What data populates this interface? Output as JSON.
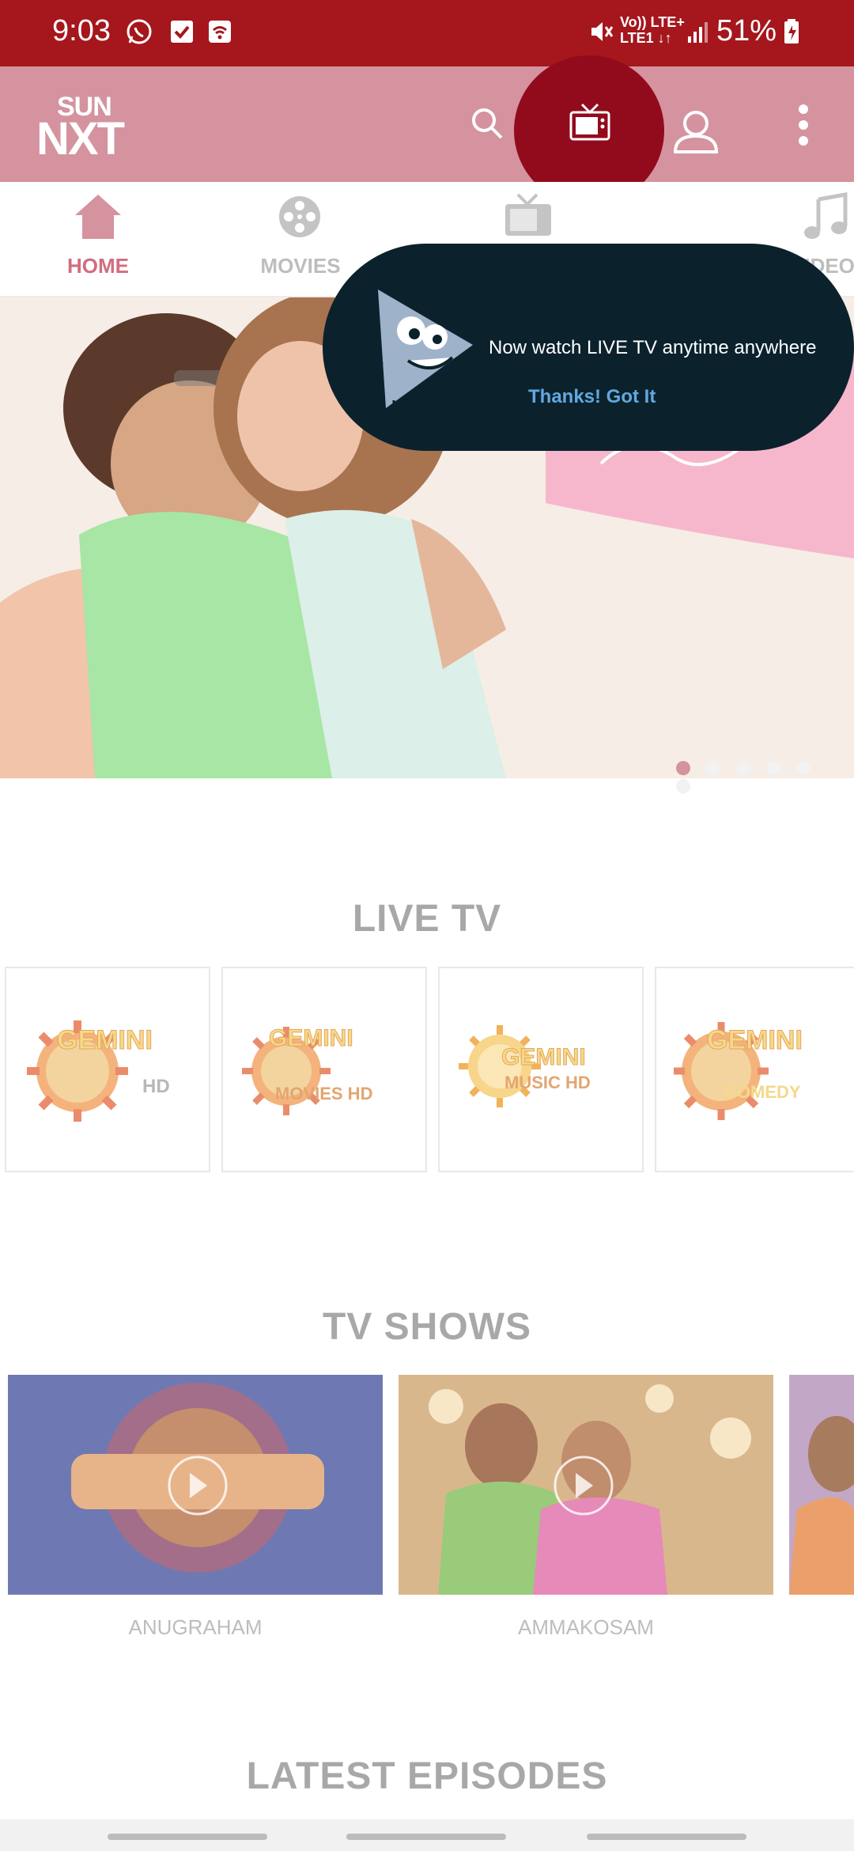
{
  "status_bar": {
    "time": "9:03",
    "lte_top": "Vo)) LTE+",
    "lte_bottom": "LTE1 ↓↑",
    "battery": "51%"
  },
  "app_bar": {
    "logo_top": "SUN",
    "logo_bottom": "NXT",
    "icons": [
      "search-icon",
      "live-tv-icon",
      "profile-icon",
      "more-vert-icon"
    ],
    "background_color": "#d4939f",
    "highlight_color": "#920b1d"
  },
  "tabs": [
    {
      "label": "HOME",
      "icon": "home-icon",
      "active": true
    },
    {
      "label": "MOVIES",
      "icon": "film-reel-icon",
      "active": false
    },
    {
      "label": "",
      "icon": "tv-icon",
      "active": false
    },
    {
      "label": "VIDEOS",
      "icon": "music-note-icon",
      "active": false
    }
  ],
  "tooltip": {
    "message": "Now watch LIVE TV anytime anywhere",
    "button": "Thanks! Got It"
  },
  "banner": {
    "slide_count": 6,
    "active_slide": 1
  },
  "live_tv": {
    "title": "LIVE TV",
    "channels": [
      {
        "name": "GEMINI",
        "suffix": "HD"
      },
      {
        "name": "GEMINI",
        "suffix": "MOVIES HD"
      },
      {
        "name": "GEMINI",
        "suffix": "MUSIC HD"
      },
      {
        "name": "GEMINI",
        "suffix": "COMEDY"
      }
    ]
  },
  "tv_shows": {
    "title": "TV SHOWS",
    "shows": [
      {
        "name": "ANUGRAHAM"
      },
      {
        "name": "AMMAKOSAM"
      }
    ]
  },
  "latest_episodes": {
    "title": "LATEST EPISODES"
  }
}
